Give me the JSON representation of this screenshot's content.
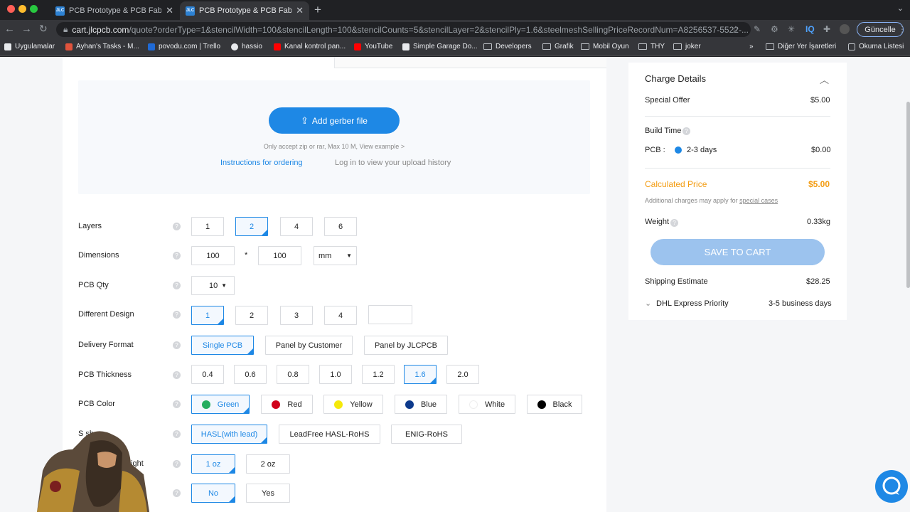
{
  "browser": {
    "tabs": [
      {
        "title": "PCB Prototype & PCB Fabricati",
        "favicon": "JLC"
      },
      {
        "title": "PCB Prototype & PCB Fabricati",
        "favicon": "JLC"
      }
    ],
    "url_domain": "cart.jlcpcb.com",
    "url_path": "/quote?orderType=1&stencilWidth=100&stencilLength=100&stencilCounts=5&stencilLayer=2&stencilPly=1.6&steelmeshSellingPriceRecordNum=A8256537-5522-...",
    "update_label": "Güncelle",
    "ext_iq": "IQ",
    "bookmarks": [
      "Uygulamalar",
      "Ayhan's Tasks - M...",
      "povodu.com | Trello",
      "hassio",
      "Kanal kontrol pan...",
      "YouTube",
      "Simple Garage Do...",
      "Developers",
      "Grafik",
      "Mobil Oyun",
      "THY",
      "joker"
    ],
    "bookmarks_overflow": "»",
    "other_bookmarks": "Diğer Yer İşaretleri",
    "reading_list": "Okuma Listesi"
  },
  "upload": {
    "button_label": "Add gerber file",
    "hint": "Only accept zip or rar, Max 10 M, View example >",
    "instructions_link": "Instructions for ordering",
    "login_link": "Log in to view your upload history"
  },
  "form": {
    "layers": {
      "label": "Layers",
      "options": [
        "1",
        "2",
        "4",
        "6"
      ],
      "selected": "2"
    },
    "dimensions": {
      "label": "Dimensions",
      "width": "100",
      "times": "*",
      "length": "100",
      "unit": "mm"
    },
    "qty": {
      "label": "PCB Qty",
      "value": "10"
    },
    "design": {
      "label": "Different Design",
      "options": [
        "1",
        "2",
        "3",
        "4"
      ],
      "selected": "1"
    },
    "delivery": {
      "label": "Delivery Format",
      "options": [
        "Single PCB",
        "Panel by Customer",
        "Panel by JLCPCB"
      ],
      "selected": "Single PCB"
    },
    "thickness": {
      "label": "PCB Thickness",
      "options": [
        "0.4",
        "0.6",
        "0.8",
        "1.0",
        "1.2",
        "1.6",
        "2.0"
      ],
      "selected": "1.6"
    },
    "color": {
      "label": "PCB Color",
      "options": [
        {
          "name": "Green",
          "color": "#27ae60"
        },
        {
          "name": "Red",
          "color": "#d0021b"
        },
        {
          "name": "Yellow",
          "color": "#f5e90a"
        },
        {
          "name": "Blue",
          "color": "#0d3a8c"
        },
        {
          "name": "White",
          "color": "#ffffff"
        },
        {
          "name": "Black",
          "color": "#000000"
        }
      ],
      "selected": "Green"
    },
    "finish": {
      "label_visible": "S          sh",
      "options": [
        "HASL(with lead)",
        "LeadFree HASL-RoHS",
        "ENIG-RoHS"
      ],
      "selected": "HASL(with lead)"
    },
    "copper": {
      "label_visible": "eight",
      "options": [
        "1 oz",
        "2 oz"
      ],
      "selected": "1 oz"
    },
    "extra": {
      "options": [
        "No",
        "Yes"
      ],
      "selected": "No"
    }
  },
  "charges": {
    "title": "Charge Details",
    "special_offer_label": "Special Offer",
    "special_offer_value": "$5.00",
    "build_time_label": "Build Time",
    "pcb_label": "PCB :",
    "pcb_time": "2-3 days",
    "pcb_price": "$0.00",
    "calc_label": "Calculated Price",
    "calc_value": "$5.00",
    "additional_note": "Additional charges may apply for",
    "special_cases": "special cases",
    "weight_label": "Weight",
    "weight_value": "0.33kg",
    "save_label": "SAVE TO CART",
    "shipping_label": "Shipping Estimate",
    "shipping_value": "$28.25",
    "carrier": "DHL Express Priority",
    "carrier_time": "3-5 business days"
  },
  "colors": {
    "accent": "#1e88e5",
    "price_orange": "#f39c12"
  }
}
